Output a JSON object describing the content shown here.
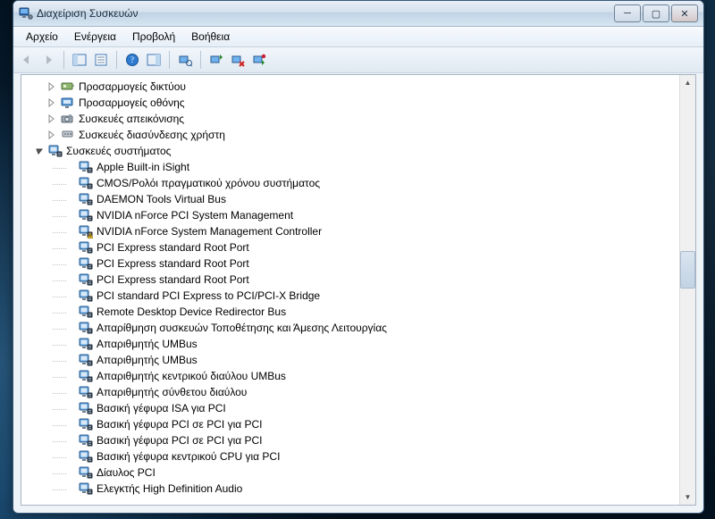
{
  "window": {
    "title": "Διαχείριση Συσκευών"
  },
  "menubar": {
    "file": "Αρχείο",
    "action": "Ενέργεια",
    "view": "Προβολή",
    "help": "Βοήθεια"
  },
  "tree": {
    "categories": [
      {
        "label": "Προσαρμογείς δικτύου",
        "expander": "closed",
        "icon": "network-adapter-icon"
      },
      {
        "label": "Προσαρμογείς οθόνης",
        "expander": "closed",
        "icon": "display-adapter-icon"
      },
      {
        "label": "Συσκευές απεικόνισης",
        "expander": "closed",
        "icon": "imaging-device-icon"
      },
      {
        "label": "Συσκευές διασύνδεσης χρήστη",
        "expander": "closed",
        "icon": "hid-device-icon"
      }
    ],
    "open_category": {
      "label": "Συσκευές συστήματος",
      "expander": "open",
      "icon": "system-device-icon"
    },
    "devices": [
      {
        "label": "Apple Built-in iSight"
      },
      {
        "label": "CMOS/Ρολόι πραγματικού χρόνου συστήματος"
      },
      {
        "label": "DAEMON Tools Virtual Bus"
      },
      {
        "label": "NVIDIA nForce PCI System Management"
      },
      {
        "label": "NVIDIA nForce System Management Controller",
        "warning": true
      },
      {
        "label": "PCI Express standard Root Port"
      },
      {
        "label": "PCI Express standard Root Port"
      },
      {
        "label": "PCI Express standard Root Port"
      },
      {
        "label": "PCI standard PCI Express to PCI/PCI-X Bridge"
      },
      {
        "label": "Remote Desktop Device Redirector Bus"
      },
      {
        "label": "Απαρίθμηση συσκευών Τοποθέτησης και Άμεσης Λειτουργίας"
      },
      {
        "label": "Απαριθμητής UMBus"
      },
      {
        "label": "Απαριθμητής UMBus"
      },
      {
        "label": "Απαριθμητής κεντρικού διαύλου UMBus"
      },
      {
        "label": "Απαριθμητής σύνθετου διαύλου"
      },
      {
        "label": "Βασική γέφυρα ISA για PCI"
      },
      {
        "label": "Βασική γέφυρα PCI σε PCI για PCI"
      },
      {
        "label": "Βασική γέφυρα PCI σε PCI για PCI"
      },
      {
        "label": "Βασική γέφυρα κεντρικού CPU για PCI"
      },
      {
        "label": "Δίαυλος PCI"
      },
      {
        "label": "Ελεγκτής High Definition Audio"
      }
    ]
  }
}
